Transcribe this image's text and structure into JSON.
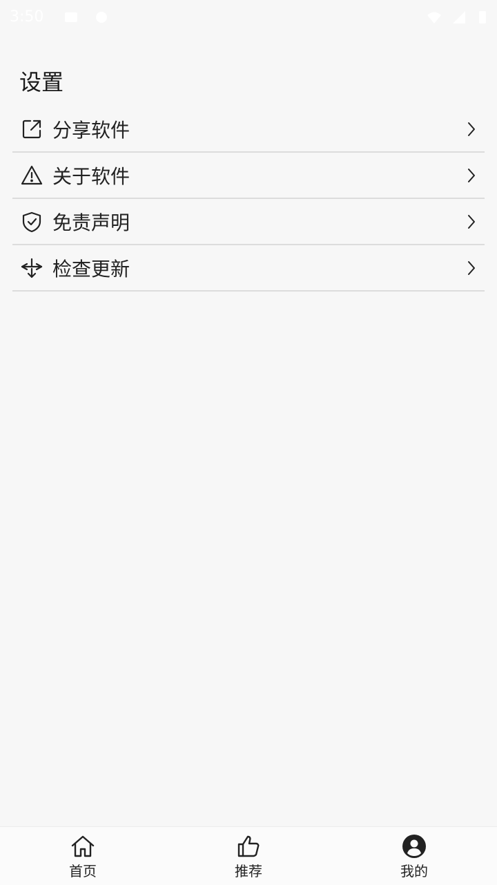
{
  "status_bar": {
    "time": "3:50"
  },
  "page": {
    "title": "设置"
  },
  "menu": {
    "items": [
      {
        "label": "分享软件",
        "icon": "share-icon"
      },
      {
        "label": "关于软件",
        "icon": "warning-icon"
      },
      {
        "label": "免责声明",
        "icon": "shield-check-icon"
      },
      {
        "label": "检查更新",
        "icon": "update-download-icon"
      }
    ]
  },
  "bottom_nav": {
    "tabs": [
      {
        "label": "首页",
        "icon": "home-icon"
      },
      {
        "label": "推荐",
        "icon": "thumbs-up-icon"
      },
      {
        "label": "我的",
        "icon": "user-circle-icon",
        "active": true
      }
    ]
  }
}
